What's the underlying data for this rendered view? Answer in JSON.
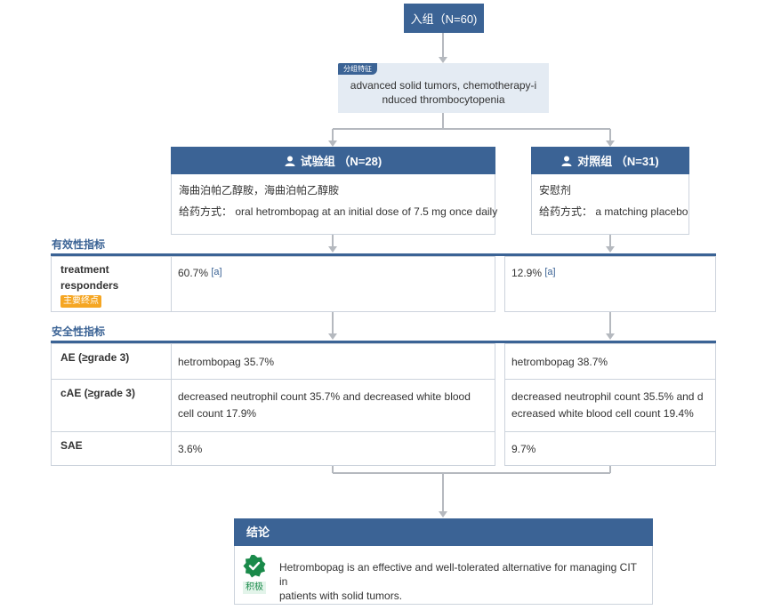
{
  "enrollment": {
    "label": "入组（N=60)"
  },
  "feature": {
    "tag": "分组特征",
    "text": "advanced solid tumors, chemotherapy-induced thrombocytopenia",
    "line1": "advanced solid tumors, chemotherapy-i",
    "line2": "nduced thrombocytopenia"
  },
  "arms": [
    {
      "header": "试验组 （N=28)",
      "drug": "海曲泊帕乙醇胺，海曲泊帕乙醇胺",
      "admin_label": "给药方式：",
      "admin_text": " oral hetrombopag at an initial dose of 7.5 mg once daily"
    },
    {
      "header": "对照组 （N=31)",
      "drug": "安慰剂",
      "admin_label": "给药方式：",
      "admin_text": " a matching placebo"
    }
  ],
  "efficacy": {
    "section_title": "有效性指标",
    "rows": [
      {
        "label_line1": "treatment",
        "label_line2": "responders",
        "badge": "主要终点",
        "values": [
          "60.7%",
          "12.9%"
        ],
        "refs": [
          "[a]",
          "[a]"
        ]
      }
    ]
  },
  "safety": {
    "section_title": "安全性指标",
    "rows": [
      {
        "label": "AE (≥grade 3)",
        "values": [
          "hetrombopag 35.7%",
          "hetrombopag 38.7%"
        ]
      },
      {
        "label": "cAE (≥grade 3)",
        "values": [
          "decreased neutrophil count 35.7% and decreased white blood cell count 17.9%",
          "decreased neutrophil count 35.5% and decreased white blood cell count 19.4%"
        ],
        "values_lines": [
          [
            "decreased neutrophil count 35.7% and decreased white blood",
            "cell count 17.9%"
          ],
          [
            "decreased neutrophil count 35.5% and d",
            "ecreased white blood cell count 19.4%"
          ]
        ]
      },
      {
        "label": "SAE",
        "values": [
          "3.6%",
          "9.7%"
        ]
      }
    ]
  },
  "conclusion": {
    "title": "结论",
    "text": "Hetrombopag is an effective and well-tolerated alternative for managing CIT in patients with solid tumors.",
    "line1": "Hetrombopag is an effective and well-tolerated alternative for managing CIT in",
    "line2": "patients with solid tumors.",
    "rating": "积极"
  },
  "colors": {
    "primary": "#3b6395",
    "badge": "#f5a623",
    "positive": "#1a8a4a",
    "connector": "#b5b9bf"
  },
  "icons": [
    "user-icon",
    "check-badge-icon"
  ]
}
